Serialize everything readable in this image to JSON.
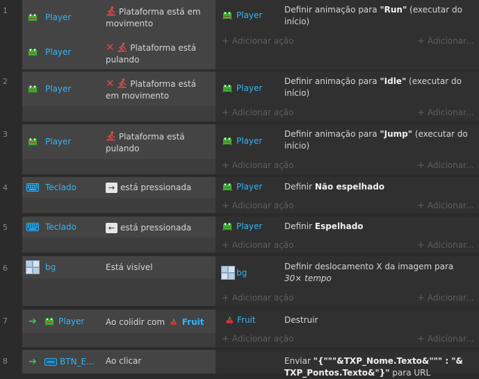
{
  "events": [
    {
      "num": "1",
      "conditions": [
        {
          "object": "Player",
          "parts": [
            {
              "t": "Plataforma está em movimento"
            }
          ]
        },
        {
          "object": "Player",
          "inverted": true,
          "parts": [
            {
              "t": "Plataforma está pulando"
            }
          ]
        }
      ],
      "actions": [
        {
          "object": "Player",
          "text_pre": "Definir animação para ",
          "bold": "\"Run\"",
          "text_post": " (executar do início)"
        }
      ]
    },
    {
      "num": "2",
      "conditions": [
        {
          "object": "Player",
          "inverted": true,
          "parts": [
            {
              "t": "Plataforma está em movimento"
            }
          ]
        }
      ],
      "actions": [
        {
          "object": "Player",
          "text_pre": "Definir animação para ",
          "bold": "\"Idle\"",
          "text_post": " (executar do início)"
        }
      ]
    },
    {
      "num": "3",
      "conditions": [
        {
          "object": "Player",
          "parts": [
            {
              "t": "Plataforma está pulando"
            }
          ]
        }
      ],
      "actions": [
        {
          "object": "Player",
          "text_pre": "Definir animação para ",
          "bold": "\"Jump\"",
          "text_post": " (executar do início)"
        }
      ]
    },
    {
      "num": "4",
      "conditions": [
        {
          "object": "Teclado",
          "key": "→",
          "text": "está pressionada"
        }
      ],
      "actions": [
        {
          "object": "Player",
          "text_pre": "Definir ",
          "bold": "Não espelhado",
          "text_post": ""
        }
      ]
    },
    {
      "num": "5",
      "conditions": [
        {
          "object": "Teclado",
          "key": "←",
          "text": "está pressionada"
        }
      ],
      "actions": [
        {
          "object": "Player",
          "text_pre": "Definir ",
          "bold": "Espelhado",
          "text_post": ""
        }
      ]
    },
    {
      "num": "6",
      "conditions": [
        {
          "object": "bg",
          "text": "Está visível"
        }
      ],
      "actions": [
        {
          "object": "bg",
          "text_pre": "Definir deslocamento X da imagem para ",
          "italic": "30× tempo"
        }
      ]
    },
    {
      "num": "7",
      "trigger": true,
      "conditions": [
        {
          "object": "Player",
          "text": "Ao colidir com",
          "with": "Fruit"
        }
      ],
      "actions": [
        {
          "object": "Fruit",
          "text_pre": "Destruir"
        }
      ]
    },
    {
      "num": "8",
      "trigger": true,
      "conditions": [
        {
          "object": "BTN_E...",
          "text": "Ao clicar"
        }
      ],
      "actions": [
        {
          "text_pre": "Enviar ",
          "bold": "\"{\"\"\"&TXP_Nome.Texto&\"\"\" : \"& TXP_Pontos.Texto&\"}\"",
          "text_post": " para URL"
        }
      ]
    }
  ],
  "labels": {
    "add_action": "Adicionar ação",
    "add_action_trunc": "Adicionar...",
    "plataforma_em_movimento": "Plataforma está em movimento",
    "plataforma_pulando": "Plataforma está pulando",
    "esta_pressionada": "está pressionada",
    "esta_visivel": "Está visível",
    "ao_colidir_com": "Ao colidir com",
    "ao_clicar": "Ao clicar"
  },
  "colors": {
    "object_name": "#33b5f5",
    "inverted_x": "#e04848",
    "trigger_arrow": "#3cc36a"
  },
  "icons": {
    "player": "frog-sprite-icon",
    "teclado": "keyboard-icon",
    "bg": "tiled-image-icon",
    "fruit": "cherry-icon",
    "platformer": "running-figure-icon",
    "trigger": "right-arrow-icon"
  }
}
